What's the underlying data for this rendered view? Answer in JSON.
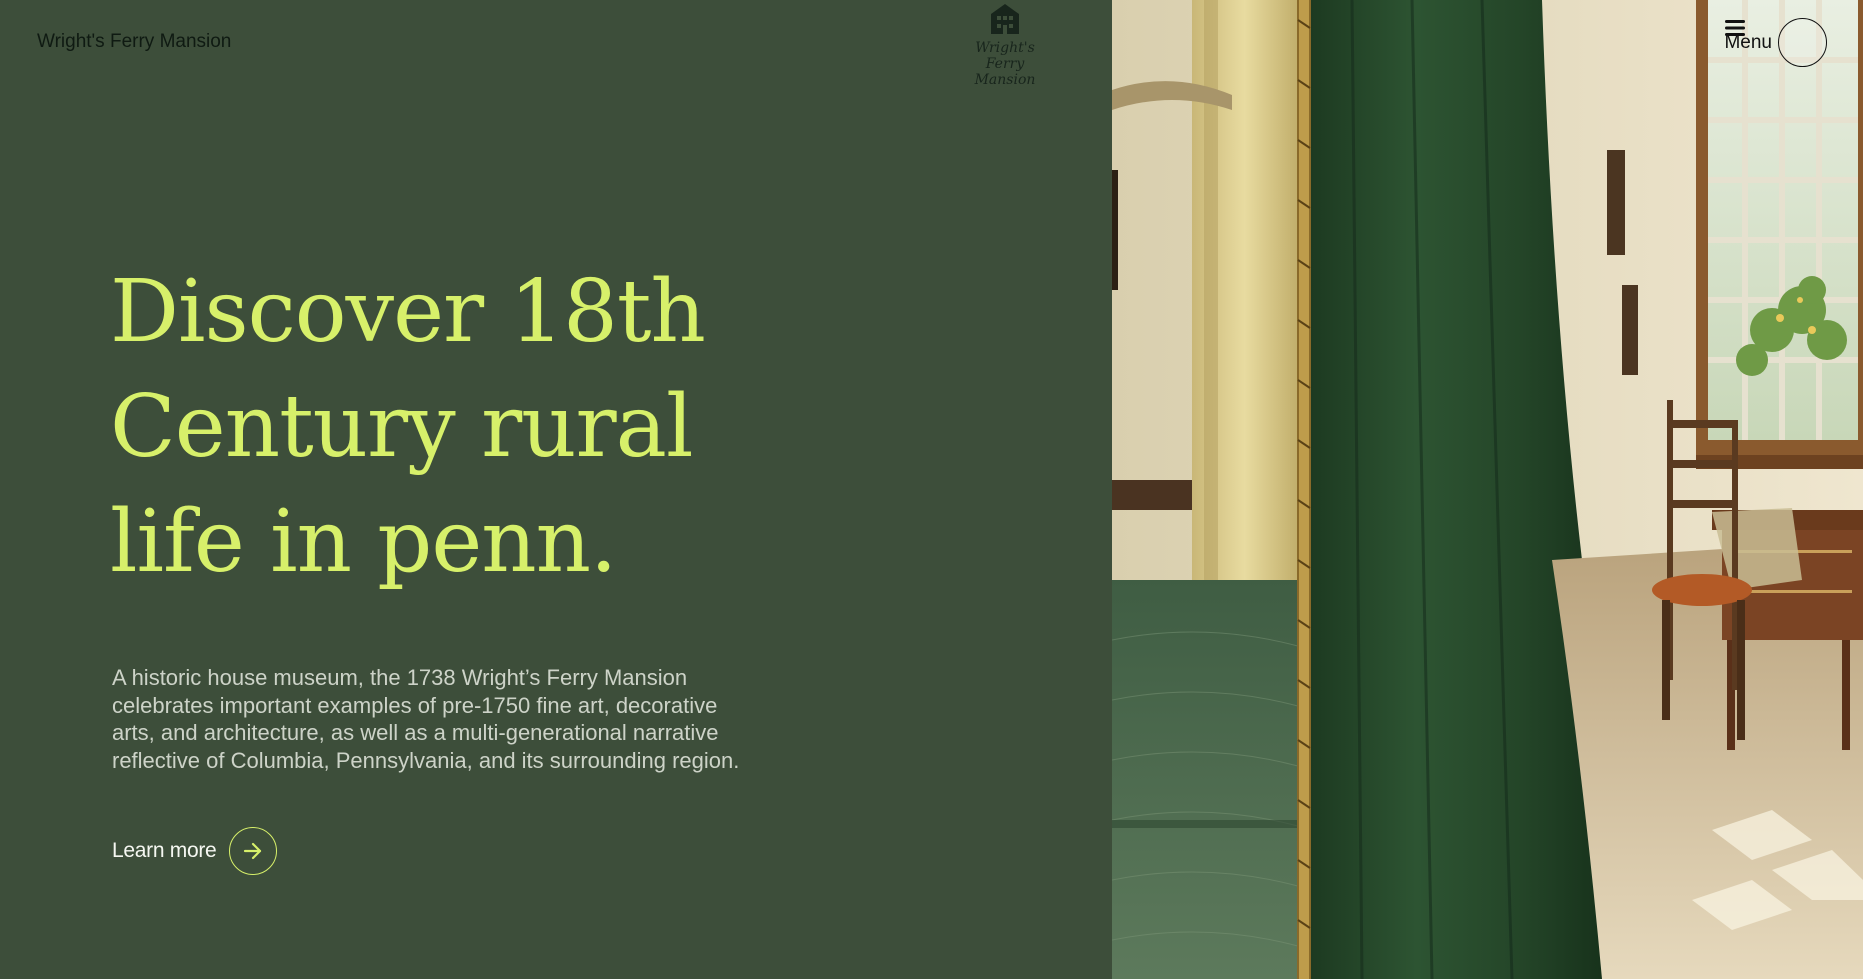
{
  "header": {
    "site_name": "Wright's Ferry Mansion",
    "logo_line1": "Wright's Ferry",
    "logo_line2": "Mansion",
    "logo_icon": "house-icon",
    "menu_label": "Menu",
    "menu_icon": "hamburger-icon"
  },
  "hero": {
    "title": "Discover 18th\nCentury rural\nlife in penn.",
    "description": "A historic house museum, the 1738 Wright’s Ferry Mansion celebrates important examples of pre-1750 fine art, decorative arts, and architecture, as well as a multi-generational narrative reflective of Columbia, Pennsylvania, and its surrounding region.",
    "cta_label": "Learn more",
    "cta_icon": "arrow-right-icon"
  },
  "colors": {
    "background": "#3d4e3a",
    "accent": "#d7f06a",
    "text_muted": "#cdd3c8",
    "text_dark": "#0f1a12"
  }
}
